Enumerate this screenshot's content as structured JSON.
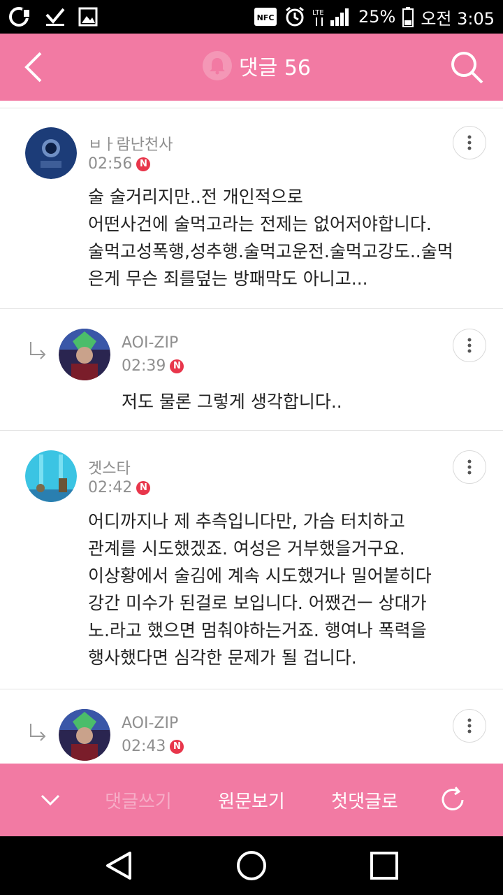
{
  "status_bar": {
    "nfc_label": "NFC",
    "lte_label": "LTE",
    "battery": "25%",
    "time": "오전 3:05"
  },
  "app_bar": {
    "title": "댓글 56"
  },
  "comments": [
    {
      "author": "ㅂㅏ람난천사",
      "time": "02:56",
      "badge": "N",
      "text": "술 술거리지만..전 개인적으로\n어떤사건에 술먹고라는 전제는 없어저야합니다.\n술먹고성폭행,성추행.술먹고운전.술먹고강도..술먹\n은게 무슨 죄를덮는 방패막도 아니고..."
    },
    {
      "author": "AOI-ZIP",
      "time": "02:39",
      "badge": "N",
      "text": "저도 물론 그렇게 생각합니다.."
    },
    {
      "author": "겟스타",
      "time": "02:42",
      "badge": "N",
      "text": "어디까지나 제 추측입니다만, 가슴 터치하고\n관계를 시도했겠죠. 여성은 거부했을거구요.\n이상황에서 술김에 계속 시도했거나 밀어붙히다\n강간 미수가 된걸로 보입니다. 어쨌건ㅡ 상대가\n노.라고 했으면 멈춰야하는거죠. 행여나 폭력을\n행사했다면 심각한 문제가 될 겁니다."
    },
    {
      "author": "AOI-ZIP",
      "time": "02:43",
      "badge": "N",
      "text": ""
    }
  ],
  "bottom_bar": {
    "write_label": "댓글쓰기",
    "original_label": "원문보기",
    "first_label": "첫댓글로"
  },
  "colors": {
    "accent": "#f27aa3",
    "badge": "#e8364b"
  }
}
